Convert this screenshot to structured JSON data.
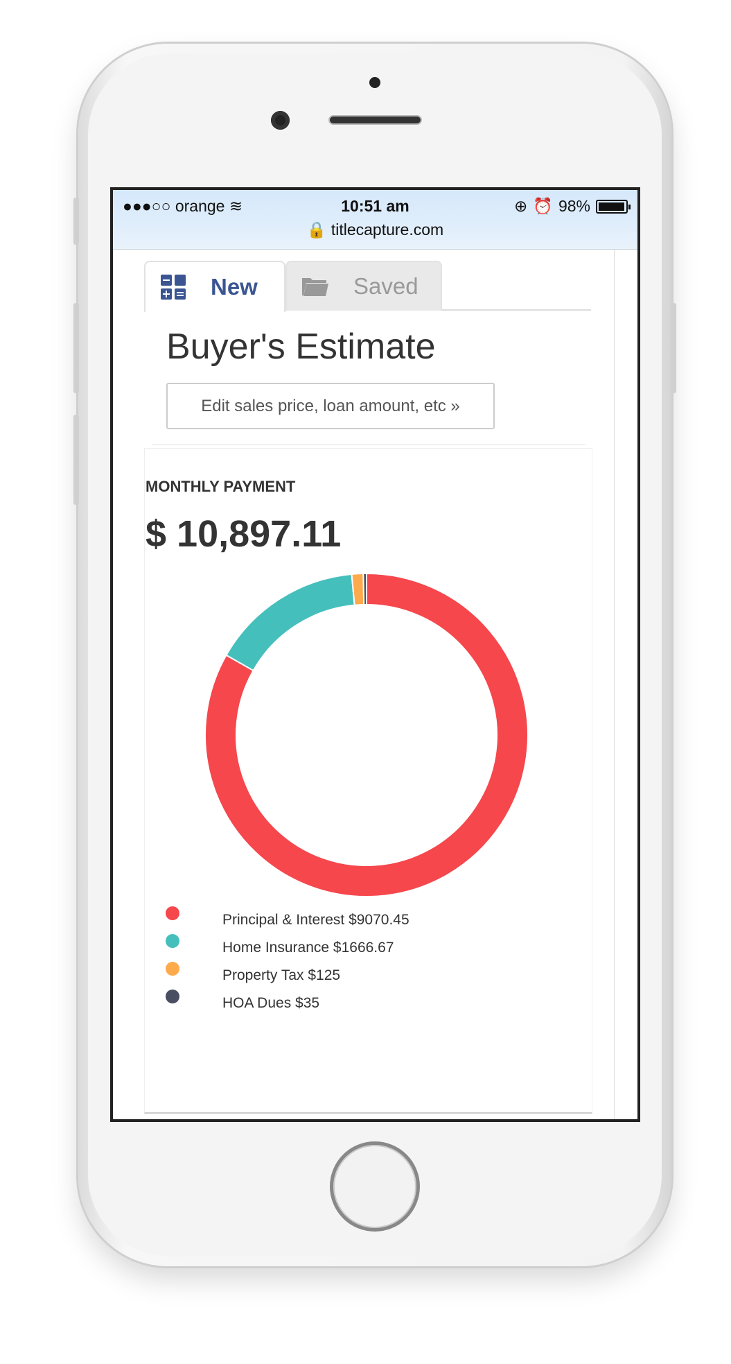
{
  "status_bar": {
    "carrier": "●●●○○ orange",
    "time": "10:51 am",
    "battery": "98%",
    "battery_level": 0.98,
    "url": "titlecapture.com"
  },
  "tabs": [
    {
      "label": "New",
      "icon": "calculator-icon",
      "active": true
    },
    {
      "label": "Saved",
      "icon": "folder-icon",
      "active": false
    }
  ],
  "page": {
    "title": "Buyer's Estimate",
    "edit_button": "Edit sales price, loan amount, etc »"
  },
  "monthly": {
    "label": "MONTHLY PAYMENT",
    "value": "$ 10,897.11"
  },
  "chart_data": {
    "type": "pie",
    "subtype": "donut",
    "categories": [
      "Principal & Interest",
      "Home Insurance",
      "Property Tax",
      "HOA Dues"
    ],
    "values": [
      9070.45,
      1666.67,
      125,
      35
    ],
    "colors": [
      "#f5474c",
      "#45bfbc",
      "#fdaa4c",
      "#4a4e61"
    ],
    "legend_labels": [
      "Principal & Interest $9070.45",
      "Home Insurance $1666.67",
      "Property Tax $125",
      "HOA Dues $35"
    ],
    "legend_placement": "bottom"
  }
}
